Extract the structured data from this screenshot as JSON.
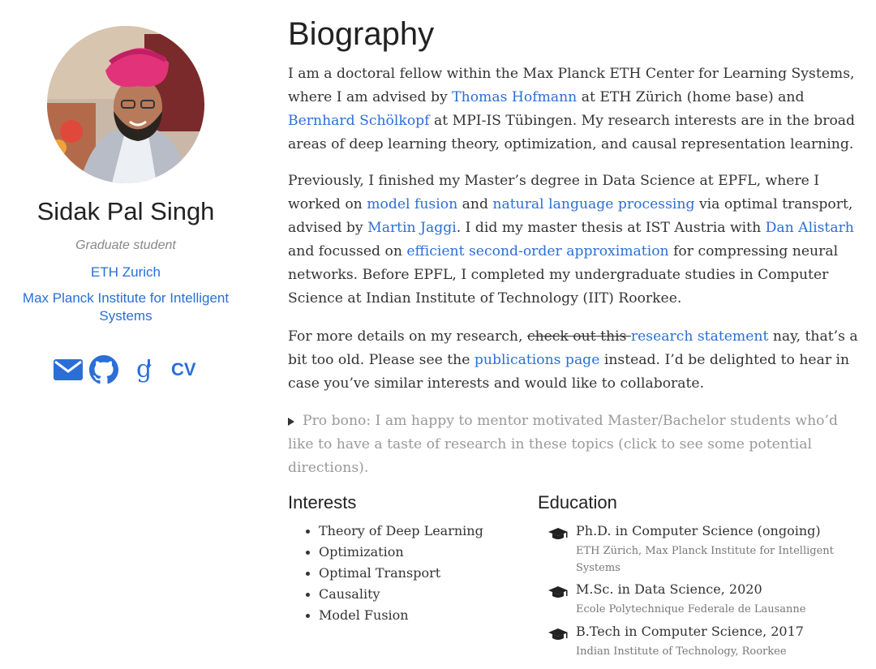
{
  "profile": {
    "name": "Sidak Pal Singh",
    "role": "Graduate student",
    "org1": "ETH Zurich",
    "org2": "Max Planck Institute for Intelligent Systems",
    "social": {
      "email_icon": "envelope-icon",
      "github_icon": "github-icon",
      "scholar_icon": "google-scholar-icon",
      "cv_label": "CV"
    }
  },
  "biography": {
    "title": "Biography",
    "p1": {
      "t1": "I am a doctoral fellow within the Max Planck ETH Center for Learning Systems, where I am advised by ",
      "link1": "Thomas Hofmann",
      "t2": " at ETH Zürich (home base) and ",
      "link2": "Bernhard Schölkopf",
      "t3": " at MPI-IS Tübingen. My research interests are in the broad areas of deep learning theory, optimization, and causal representation learning."
    },
    "p2": {
      "t1": "Previously, I finished my Master’s degree in Data Science at EPFL, where I worked on ",
      "link1": "model fusion",
      "t2": " and ",
      "link2": "natural language processing",
      "t3": " via optimal transport, advised by ",
      "link3": "Martin Jaggi",
      "t4": ". I did my master thesis at IST Austria with ",
      "link4": "Dan Alistarh",
      "t5": " and focussed on ",
      "link5": "efficient second-order approximation",
      "t6": " for compressing neural networks. Before EPFL, I completed my undergraduate studies in Computer Science at Indian Institute of Technology (IIT) Roorkee."
    },
    "p3": {
      "t1": "For more details on my research, ",
      "strike1": "check out this ",
      "strike_link": "research statement",
      "t2": " nay, that’s a bit too old. Please see the ",
      "link1": "publications page",
      "t3": " instead. I’d be delighted to hear in case you’ve similar interests and would like to collaborate."
    },
    "probono": "Pro bono: I am happy to mentor motivated Master/Bachelor students who’d like to have a taste of research in these topics (click to see some potential directions)."
  },
  "interests": {
    "title": "Interests",
    "items": [
      "Theory of Deep Learning",
      "Optimization",
      "Optimal Transport",
      "Causality",
      "Model Fusion"
    ]
  },
  "education": {
    "title": "Education",
    "items": [
      {
        "degree": "Ph.D. in Computer Science (ongoing)",
        "institution": "ETH Zürich, Max Planck Institute for Intelligent Systems"
      },
      {
        "degree": "M.Sc. in Data Science, 2020",
        "institution": "Ecole Polytechnique Federale de Lausanne"
      },
      {
        "degree": "B.Tech in Computer Science, 2017",
        "institution": "Indian Institute of Technology, Roorkee"
      }
    ]
  },
  "colors": {
    "link": "#2b6ed6",
    "text": "#333333",
    "muted": "#999999"
  }
}
